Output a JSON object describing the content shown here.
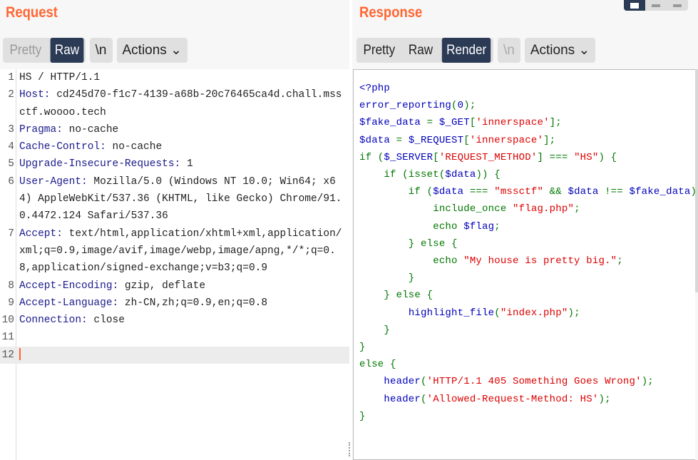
{
  "request": {
    "title": "Request",
    "tabs": [
      {
        "label": "Pretty",
        "active": false
      },
      {
        "label": "Raw",
        "active": true
      }
    ],
    "newline_button": "\\n",
    "actions_button": "Actions",
    "lines": [
      {
        "num": "1",
        "name": "",
        "value": "HS / HTTP/1.1"
      },
      {
        "num": "2",
        "name": "Host:",
        "value": " cd245d70-f1c7-4139-a68b-20c76465ca4d.chall.mssctf.woooo.tech"
      },
      {
        "num": "3",
        "name": "Pragma:",
        "value": " no-cache"
      },
      {
        "num": "4",
        "name": "Cache-Control:",
        "value": " no-cache"
      },
      {
        "num": "5",
        "name": "Upgrade-Insecure-Requests:",
        "value": " 1"
      },
      {
        "num": "6",
        "name": "User-Agent:",
        "value": " Mozilla/5.0 (Windows NT 10.0; Win64; x64) AppleWebKit/537.36 (KHTML, like Gecko) Chrome/91.0.4472.124 Safari/537.36"
      },
      {
        "num": "7",
        "name": "Accept:",
        "value": " text/html,application/xhtml+xml,application/xml;q=0.9,image/avif,image/webp,image/apng,*/*;q=0.8,application/signed-exchange;v=b3;q=0.9"
      },
      {
        "num": "8",
        "name": "Accept-Encoding:",
        "value": " gzip, deflate"
      },
      {
        "num": "9",
        "name": "Accept-Language:",
        "value": " zh-CN,zh;q=0.9,en;q=0.8"
      },
      {
        "num": "10",
        "name": "Connection:",
        "value": " close"
      },
      {
        "num": "11",
        "name": "",
        "value": ""
      },
      {
        "num": "12",
        "name": "",
        "value": ""
      }
    ]
  },
  "response": {
    "title": "Response",
    "tabs": [
      {
        "label": "Pretty",
        "active": false
      },
      {
        "label": "Raw",
        "active": false
      },
      {
        "label": "Render",
        "active": true
      }
    ],
    "newline_button": "\\n",
    "actions_button": "Actions",
    "colors": {
      "b": "#0000bb",
      "g": "#007700",
      "r": "#dd0000"
    },
    "code": [
      [
        [
          "b",
          "<?php"
        ]
      ],
      [
        [
          "b",
          "error_reporting"
        ],
        [
          "g",
          "("
        ],
        [
          "b",
          "0"
        ],
        [
          "g",
          ");"
        ]
      ],
      [
        [
          "b",
          "$fake_data "
        ],
        [
          "g",
          "= "
        ],
        [
          "b",
          "$_GET"
        ],
        [
          "g",
          "["
        ],
        [
          "r",
          "'innerspace'"
        ],
        [
          "g",
          "];"
        ]
      ],
      [
        [
          "b",
          "$data "
        ],
        [
          "g",
          "= "
        ],
        [
          "b",
          "$_REQUEST"
        ],
        [
          "g",
          "["
        ],
        [
          "r",
          "'innerspace'"
        ],
        [
          "g",
          "];"
        ]
      ],
      [
        [
          "g",
          "if ("
        ],
        [
          "b",
          "$_SERVER"
        ],
        [
          "g",
          "["
        ],
        [
          "r",
          "'REQUEST_METHOD'"
        ],
        [
          "g",
          "] === "
        ],
        [
          "r",
          "\"HS\""
        ],
        [
          "g",
          ") {"
        ]
      ],
      [
        [
          "g",
          "    if (isset("
        ],
        [
          "b",
          "$data"
        ],
        [
          "g",
          ")) {"
        ]
      ],
      [
        [
          "g",
          "        if ("
        ],
        [
          "b",
          "$data "
        ],
        [
          "g",
          "=== "
        ],
        [
          "r",
          "\"mssctf\" "
        ],
        [
          "g",
          "&& "
        ],
        [
          "b",
          "$data "
        ],
        [
          "g",
          "!== "
        ],
        [
          "b",
          "$fake_data"
        ],
        [
          "g",
          ") {"
        ]
      ],
      [
        [
          "g",
          "            include_once "
        ],
        [
          "r",
          "\"flag.php\""
        ],
        [
          "g",
          ";"
        ]
      ],
      [
        [
          "g",
          "            echo "
        ],
        [
          "b",
          "$flag"
        ],
        [
          "g",
          ";"
        ]
      ],
      [
        [
          "g",
          "        } else {"
        ]
      ],
      [
        [
          "g",
          "            echo "
        ],
        [
          "r",
          "\"My house is pretty big.\""
        ],
        [
          "g",
          ";"
        ]
      ],
      [
        [
          "g",
          "        }"
        ]
      ],
      [
        [
          "g",
          "    } else {"
        ]
      ],
      [
        [
          "g",
          "        "
        ],
        [
          "b",
          "highlight_file"
        ],
        [
          "g",
          "("
        ],
        [
          "r",
          "\"index.php\""
        ],
        [
          "g",
          ");"
        ]
      ],
      [
        [
          "g",
          "    }"
        ]
      ],
      [
        [
          "g",
          "}"
        ]
      ],
      [
        [
          "g",
          "else {"
        ]
      ],
      [
        [
          "g",
          "    "
        ],
        [
          "b",
          "header"
        ],
        [
          "g",
          "("
        ],
        [
          "r",
          "'HTTP/1.1 405 Something Goes Wrong'"
        ],
        [
          "g",
          ");"
        ]
      ],
      [
        [
          "g",
          "    "
        ],
        [
          "b",
          "header"
        ],
        [
          "g",
          "("
        ],
        [
          "r",
          "'Allowed-Request-Method: HS'"
        ],
        [
          "g",
          ");"
        ]
      ],
      [
        [
          "g",
          "}"
        ]
      ]
    ]
  },
  "view_toggle": {
    "active": "split-horizontal"
  }
}
